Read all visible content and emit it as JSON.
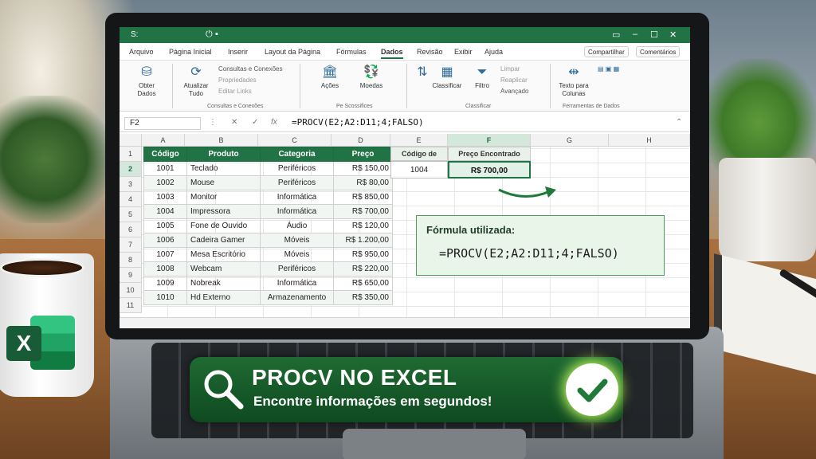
{
  "window": {
    "title": "S:"
  },
  "menu": {
    "tabs": [
      "Arquivo",
      "Página Inicial",
      "Inserir",
      "Layout da Página",
      "Fórmulas",
      "Dados",
      "Revisão",
      "Exibir",
      "Ajuda"
    ],
    "active_tab": "Dados",
    "share": "Compartilhar",
    "comments": "Comentários"
  },
  "ribbon": {
    "obter_dados": "Obter Dados",
    "atualizar_tudo": "Atualizar Tudo",
    "consultas": "Consultas e Conexões",
    "propriedades": "Propriedades",
    "editar_links": "Editar Links",
    "group_consultas": "Consultas e Conexões",
    "acoes": "Ações",
    "moedas": "Moedas",
    "group_tipos": "Pe Scossifices",
    "classificar": "Classificar",
    "filtro": "Filtro",
    "limpar": "Limpar",
    "reaplicar": "Reaplicar",
    "avancado": "Avançado",
    "group_classificar": "Classificar",
    "texto_colunas": "Texto para Colunas",
    "group_ferramentas": "Ferramentas de Dados"
  },
  "formula_bar": {
    "name_box": "F2",
    "fx": "fx",
    "formula": "=PROCV(E2;A2:D11;4;FALSO)"
  },
  "columns": [
    "A",
    "B",
    "C",
    "D",
    "E",
    "F",
    "G",
    "H"
  ],
  "active_col": "F",
  "rows": [
    "1",
    "2",
    "3",
    "4",
    "5",
    "6",
    "7",
    "8",
    "9",
    "10",
    "11"
  ],
  "active_row": "2",
  "table": {
    "headers": [
      "Código",
      "Produto",
      "Categoria",
      "Preço"
    ],
    "rows": [
      [
        "1001",
        "Teclado",
        "Periféricos",
        "R$ 150,00"
      ],
      [
        "1002",
        "Mouse",
        "Periféricos",
        "R$ 80,00"
      ],
      [
        "1003",
        "Monitor",
        "Informática",
        "R$ 850,00"
      ],
      [
        "1004",
        "Impressora",
        "Informática",
        "R$ 700,00"
      ],
      [
        "1005",
        "Fone de Ouvido",
        "Áudio",
        "R$ 120,00"
      ],
      [
        "1006",
        "Cadeira Gamer",
        "Móveis",
        "R$ 1.200,00"
      ],
      [
        "1007",
        "Mesa Escritório",
        "Móveis",
        "R$ 950,00"
      ],
      [
        "1008",
        "Webcam",
        "Periféricos",
        "R$ 220,00"
      ],
      [
        "1009",
        "Nobreak",
        "Informática",
        "R$ 650,00"
      ],
      [
        "1010",
        "Hd Externo",
        "Armazenamento",
        "R$ 350,00"
      ]
    ]
  },
  "lookup": {
    "search_header": "Código de Busca",
    "result_header": "Preço Encontrado",
    "search_value": "1004",
    "result_value": "R$ 700,00"
  },
  "formula_box": {
    "label": "Fórmula utilizada:",
    "formula": "=PROCV(E2;A2:D11;4;FALSO)"
  },
  "banner": {
    "title": "PROCV NO EXCEL",
    "subtitle": "Encontre informações em segundos!"
  },
  "colors": {
    "excel_green": "#217346",
    "banner_green": "#1f6a33",
    "check_glow": "#b8f25a"
  }
}
